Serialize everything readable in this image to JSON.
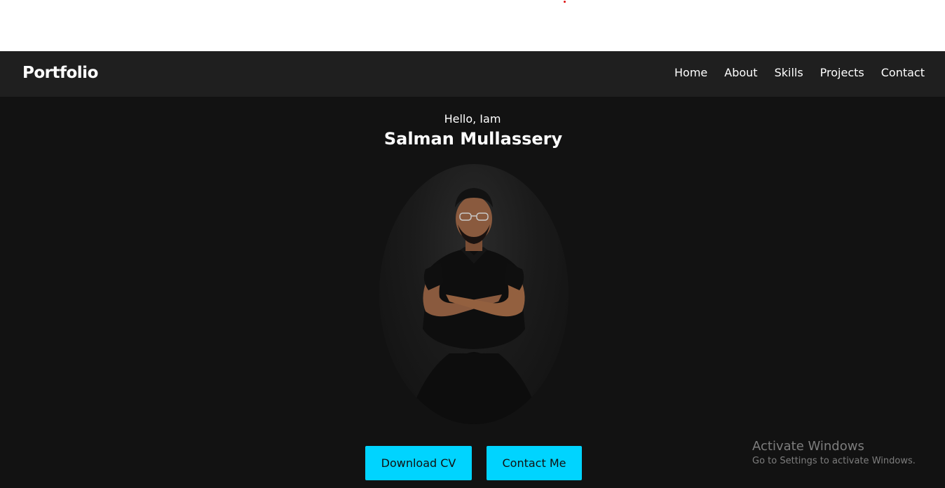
{
  "navbar": {
    "brand": "Portfolio",
    "links": [
      "Home",
      "About",
      "Skills",
      "Projects",
      "Contact"
    ]
  },
  "hero": {
    "greeting": "Hello, Iam",
    "name": "Salman Mullassery",
    "buttons": {
      "download_cv": "Download CV",
      "contact_me": "Contact Me"
    }
  },
  "watermark": {
    "title": "Activate Windows",
    "subtitle": "Go to Settings to activate Windows."
  },
  "colors": {
    "navbar_bg": "#1f1f1f",
    "hero_bg": "#121212",
    "button_accent": "#00d4ff",
    "text": "#ffffff"
  }
}
